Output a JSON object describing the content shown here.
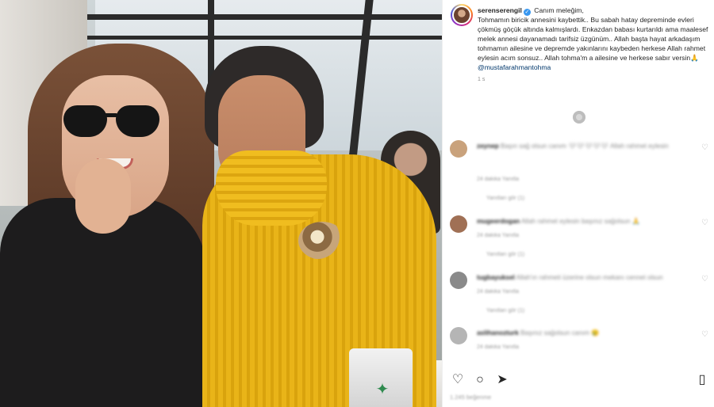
{
  "post": {
    "username": "serenserengil",
    "caption_lines": [
      "Canım meleğim,",
      "Tohmamın biricik annesini kaybettik.. Bu sabah hatay depreminde evleri çökmüş göçük altında kalmışlardı. Enkazdan babası kurtarıldı ama maalesef melek annesi dayanamadı tarifsiz üzgünüm.. Allah başta hayat arkadaşım tohmamın ailesine ve depremde yakınlarını kaybeden herkese Allah rahmet eylesin acım sonsuz.. Allah tohma'm a ailesine ve herkese sabır versin🙏"
    ],
    "mention": "@mustafarahmantohma",
    "time": "1 s"
  },
  "comments": [
    {
      "username": "zeynep",
      "text": "Başın sağ olsun canım 🤍🤍🤍🤍🤍 Allah rahmet eylesin",
      "meta": "24 dakika   Yanıtla",
      "replies": "Yanıtları gör (1)",
      "avatar_color": "#c9a27c"
    },
    {
      "username": "mugeerdogan",
      "text": "Allah rahmet eylesin başınız sağolsun 🙏",
      "meta": "24 dakika   Yanıtla",
      "replies": "Yanıtları gör (1)",
      "avatar_color": "#a07055"
    },
    {
      "username": "tugbayuksel",
      "text": "Allah'ın rahmeti üzerine olsun mekanı cennet olsun",
      "meta": "24 dakika   Yanıtla",
      "replies": "Yanıtları gör (1)",
      "avatar_color": "#8a8a8a"
    },
    {
      "username": "aslihanozturk",
      "text": "Başınız sağolsun canım 😢",
      "meta": "24 dakika   Yanıtla",
      "replies": "Yanıtları gör (1)",
      "avatar_color": "#b5b5b5"
    }
  ],
  "icons": {
    "like": "heart-icon",
    "comment": "comment-icon",
    "share": "share-icon",
    "save": "bookmark-icon"
  },
  "likes_text": "1.245 beğenme"
}
